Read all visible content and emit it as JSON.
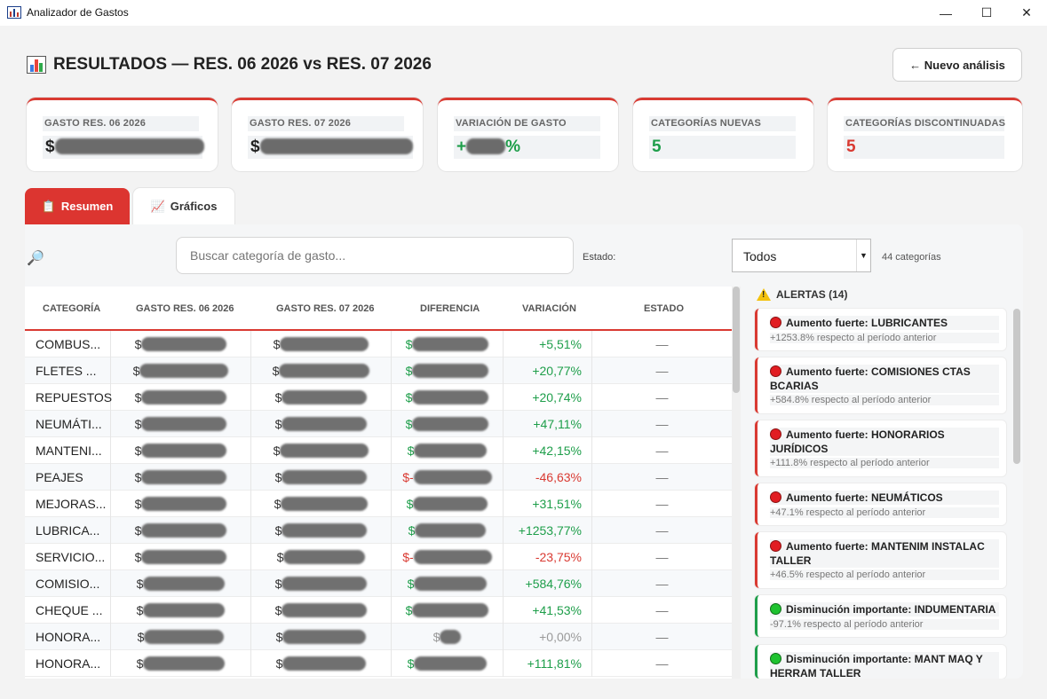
{
  "window": {
    "title": "Analizador de Gastos",
    "controls": [
      "—",
      "☐",
      "✕"
    ]
  },
  "header": {
    "title": "RESULTADOS — RES. 06 2026 vs RES. 07 2026",
    "new_button": "← Nuevo análisis"
  },
  "cards": [
    {
      "label": "GASTO RES. 06 2026",
      "prefix": "$",
      "suffix": "",
      "value_color": "#222222"
    },
    {
      "label": "GASTO RES. 07 2026",
      "prefix": "$",
      "suffix": "",
      "value_color": "#222222"
    },
    {
      "label": "VARIACIÓN DE GASTO",
      "prefix": "+",
      "suffix": "%",
      "value_color": "#1e9e4a"
    },
    {
      "label": "CATEGORÍAS NUEVAS",
      "prefix": "5",
      "suffix": "",
      "value_color": "#1e9e4a"
    },
    {
      "label": "CATEGORÍAS DISCONTINUADAS",
      "prefix": "5",
      "suffix": "",
      "value_color": "#d93a32"
    }
  ],
  "tabs": [
    {
      "label": "Resumen",
      "active": true
    },
    {
      "label": "Gráficos",
      "active": false
    }
  ],
  "filters": {
    "search_placeholder": "Buscar categoría de gasto...",
    "estado_label": "Estado:",
    "estado_value": "Todos",
    "count": "44 categorías"
  },
  "table": {
    "headers": [
      "CATEGORÍA",
      "GASTO RES. 06 2026",
      "GASTO RES. 07 2026",
      "DIFERENCIA",
      "VARIACIÓN",
      "ESTADO"
    ],
    "rows": [
      {
        "cat": "COMBUS...",
        "dif_sign": "$",
        "var": "+5,51%",
        "trend": "g",
        "estado": "—"
      },
      {
        "cat": "FLETES ...",
        "dif_sign": "$",
        "var": "+20,77%",
        "trend": "g",
        "estado": "—"
      },
      {
        "cat": "REPUESTOS",
        "dif_sign": "$",
        "var": "+20,74%",
        "trend": "g",
        "estado": "—"
      },
      {
        "cat": "NEUMÁTI...",
        "dif_sign": "$",
        "var": "+47,11%",
        "trend": "g",
        "estado": "—"
      },
      {
        "cat": "MANTENI...",
        "dif_sign": "$",
        "var": "+42,15%",
        "trend": "g",
        "estado": "—"
      },
      {
        "cat": "PEAJES",
        "dif_sign": "$-",
        "var": "-46,63%",
        "trend": "r",
        "estado": "—"
      },
      {
        "cat": "MEJORAS...",
        "dif_sign": "$",
        "var": "+31,51%",
        "trend": "g",
        "estado": "—"
      },
      {
        "cat": "LUBRICA...",
        "dif_sign": "$",
        "var": "+1253,77%",
        "trend": "g",
        "estado": "—"
      },
      {
        "cat": "SERVICIO...",
        "dif_sign": "$-",
        "var": "-23,75%",
        "trend": "r",
        "estado": "—"
      },
      {
        "cat": "COMISIO...",
        "dif_sign": "$",
        "var": "+584,76%",
        "trend": "g",
        "estado": "—"
      },
      {
        "cat": "CHEQUE ...",
        "dif_sign": "$",
        "var": "+41,53%",
        "trend": "g",
        "estado": "—"
      },
      {
        "cat": "HONORA...",
        "dif_sign": "$",
        "var": "+0,00%",
        "trend": "n",
        "estado": "—"
      },
      {
        "cat": "HONORA...",
        "dif_sign": "$",
        "var": "+111,81%",
        "trend": "g",
        "estado": "—"
      }
    ]
  },
  "alerts": {
    "title": "ALERTAS (14)",
    "items": [
      {
        "type": "up",
        "title": "Aumento fuerte: LUBRICANTES",
        "detail": "+1253.8% respecto al período anterior"
      },
      {
        "type": "up",
        "title": "Aumento fuerte: COMISIONES CTAS BCARIAS",
        "detail": "+584.8% respecto al período anterior"
      },
      {
        "type": "up",
        "title": "Aumento fuerte: HONORARIOS JURÍDICOS",
        "detail": "+111.8% respecto al período anterior"
      },
      {
        "type": "up",
        "title": "Aumento fuerte: NEUMÁTICOS",
        "detail": "+47.1% respecto al período anterior"
      },
      {
        "type": "up",
        "title": "Aumento fuerte: MANTENIM INSTALAC TALLER",
        "detail": "+46.5% respecto al período anterior"
      },
      {
        "type": "down",
        "title": "Disminución importante: INDUMENTARIA",
        "detail": "-97.1% respecto al período anterior"
      },
      {
        "type": "down",
        "title": "Disminución importante: MANT MAQ Y HERRAM TALLER",
        "detail": ""
      }
    ]
  },
  "colors": {
    "accent": "#dc3530",
    "positive": "#1e9e4a",
    "negative": "#d93a32"
  }
}
